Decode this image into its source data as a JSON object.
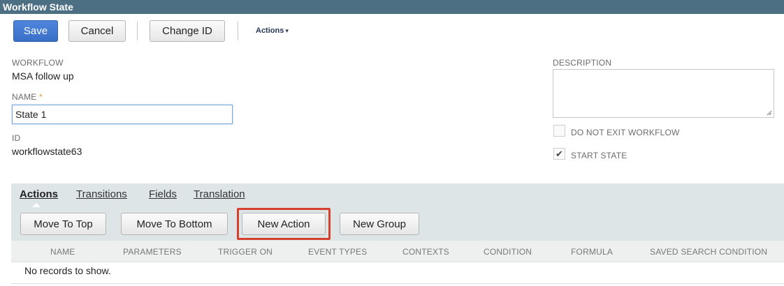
{
  "window": {
    "title": "Workflow State"
  },
  "toolbar": {
    "save_label": "Save",
    "cancel_label": "Cancel",
    "change_id_label": "Change ID",
    "actions_label": "Actions",
    "actions_caret": "▾"
  },
  "form": {
    "workflow_label": "WORKFLOW",
    "workflow_value": "MSA follow up",
    "name_label": "NAME",
    "name_required_marker": "*",
    "name_value": "State 1",
    "id_label": "ID",
    "id_value": "workflowstate63",
    "description_label": "DESCRIPTION",
    "description_value": "",
    "do_not_exit_label": "DO NOT EXIT WORKFLOW",
    "do_not_exit_checked": false,
    "start_state_label": "START STATE",
    "start_state_checked": true,
    "start_state_check_glyph": "✔"
  },
  "subtabs": [
    {
      "label": "Actions",
      "active": true
    },
    {
      "label": "Transitions",
      "active": false
    },
    {
      "label": "Fields",
      "active": false
    },
    {
      "label": "Translation",
      "active": false
    }
  ],
  "subtoolbar": {
    "move_top_label": "Move To Top",
    "move_bottom_label": "Move To Bottom",
    "new_action_label": "New Action",
    "new_group_label": "New Group"
  },
  "grid": {
    "columns": [
      "NAME",
      "PARAMETERS",
      "TRIGGER ON",
      "EVENT TYPES",
      "CONTEXTS",
      "CONDITION",
      "FORMULA",
      "SAVED SEARCH CONDITION"
    ],
    "empty_text": "No records to show."
  },
  "colors": {
    "header_bar": "#4d6f84",
    "primary_button": "#3a6fc7",
    "subpanel": "#dde5e7",
    "highlight": "#d6412f",
    "required_star": "#e0a22a"
  }
}
